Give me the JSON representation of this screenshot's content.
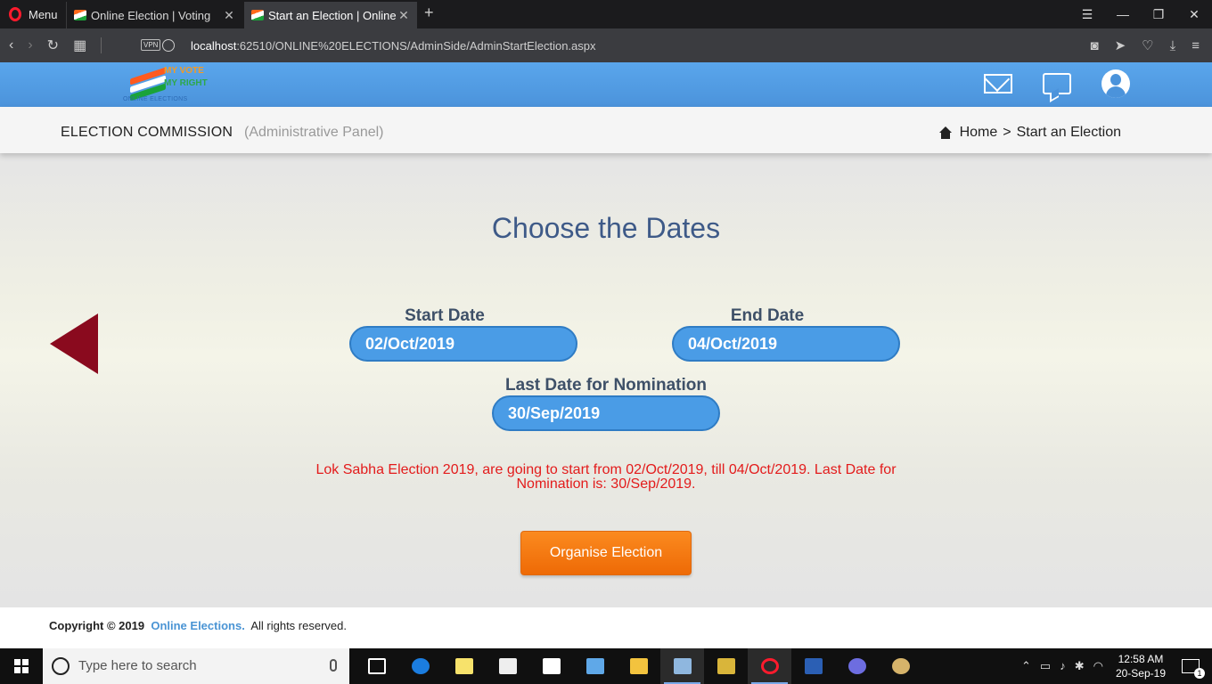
{
  "browser": {
    "menu_label": "Menu",
    "tabs": [
      {
        "title": "Online Election | Voting"
      },
      {
        "title": "Start an Election | Online El"
      }
    ],
    "new_tab": "+",
    "url_host": "localhost",
    "url_path": ":62510/ONLINE%20ELECTIONS/AdminSide/AdminStartElection.aspx",
    "vpn_label": "VPN"
  },
  "header": {
    "logo_line1": "MY VOTE",
    "logo_line2": "MY RIGHT",
    "logo_line3": "ONLINE ELECTIONS",
    "logo_colors": [
      "#ff5a1f",
      "#ffffff",
      "#1aa33a"
    ]
  },
  "subheader": {
    "title": "ELECTION COMMISSION",
    "subtitle": "(Administrative Panel)",
    "breadcrumb_home": "Home",
    "breadcrumb_sep": ">",
    "breadcrumb_current": "Start an Election"
  },
  "main": {
    "heading": "Choose the Dates",
    "start_label": "Start Date",
    "start_value": "02/Oct/2019",
    "end_label": "End Date",
    "end_value": "04/Oct/2019",
    "nomination_label": "Last Date for Nomination",
    "nomination_value": "30/Sep/2019",
    "message_line1": "Lok Sabha Election 2019, are going to start from 02/Oct/2019, till 04/Oct/2019. Last Date for",
    "message_line2": "Nomination is: 30/Sep/2019.",
    "organise_button": "Organise Election"
  },
  "footer": {
    "prefix": "Copyright © 2019",
    "brand": "Online Elections.",
    "suffix": "All rights reserved."
  },
  "taskbar": {
    "search_placeholder": "Type here to search",
    "time": "12:58 AM",
    "date": "20-Sep-19",
    "notification_count": "1"
  },
  "colors": {
    "header_blue": "#4b93db",
    "heading_blue": "#3e5a88",
    "input_blue": "#4a9ce6",
    "message_red": "#e31b1b",
    "button_orange": "#f47b12",
    "back_arrow": "#8a0a1e"
  }
}
